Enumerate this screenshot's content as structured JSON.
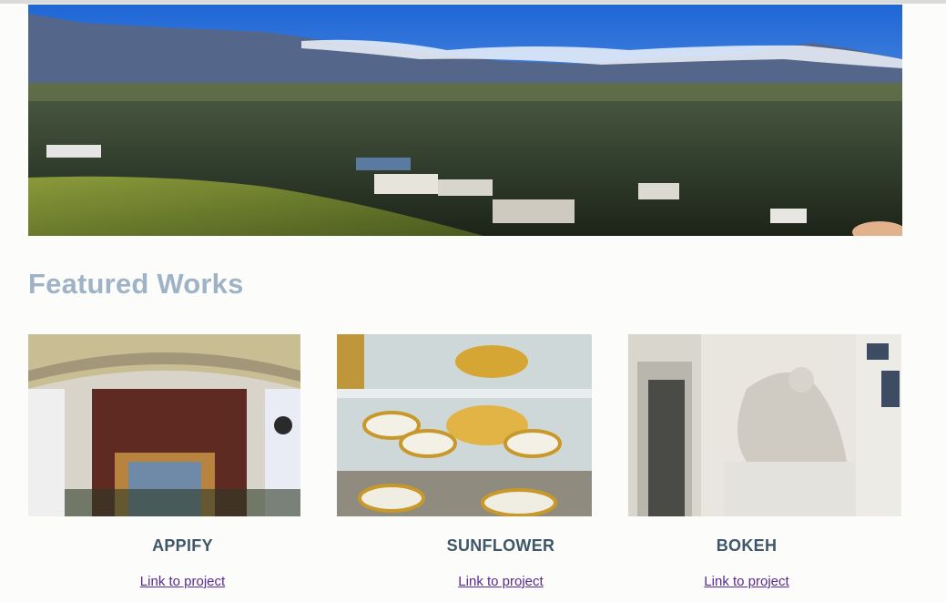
{
  "hero": {
    "image": "landscape-photo"
  },
  "featured": {
    "title": "Featured Works",
    "projects": [
      {
        "name": "APPIFY",
        "link_label": "Link to project",
        "image": "church-altar-photo"
      },
      {
        "name": "SUNFLOWER",
        "link_label": "Link to project",
        "image": "gold-porcelain-photo"
      },
      {
        "name": "BOKEH",
        "link_label": "Link to project",
        "image": "statue-building-photo"
      }
    ]
  },
  "colors": {
    "title": "#9fb3c6",
    "project_name": "#3f5668",
    "link": "#5a2a91",
    "background": "#fcfcfb"
  }
}
